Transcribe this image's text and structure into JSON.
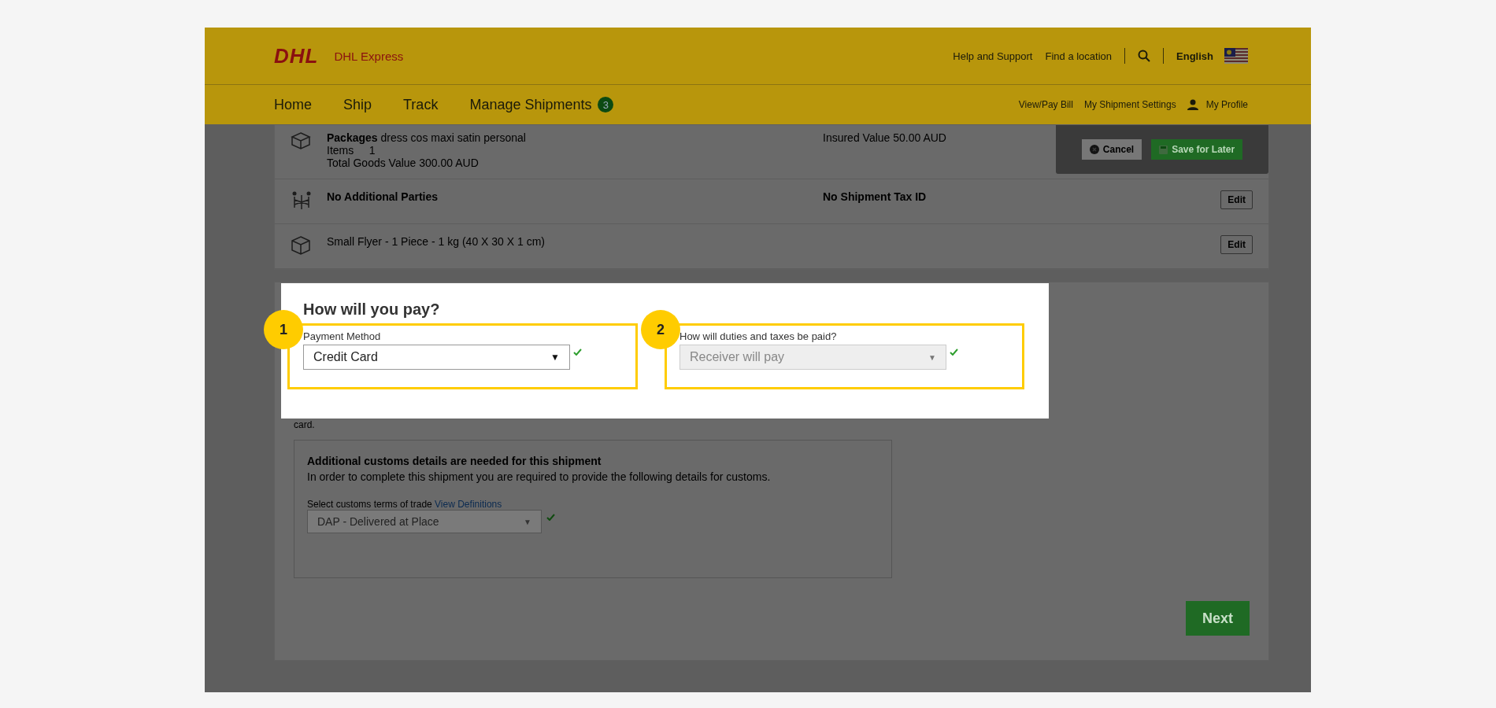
{
  "header": {
    "logo_mark": "DHL",
    "logo_name": "DHL Express",
    "links": [
      "Help and Support",
      "Find a location"
    ],
    "language": "English"
  },
  "nav": {
    "items": [
      {
        "label": "Home"
      },
      {
        "label": "Ship"
      },
      {
        "label": "Track"
      },
      {
        "label": "Manage Shipments",
        "badge": "3"
      }
    ],
    "right_links": [
      "View/Pay Bill",
      "My Shipment Settings"
    ],
    "profile": "My Profile"
  },
  "summary": {
    "rows": [
      {
        "kind": "packages",
        "lines": [
          "**Packages** dress cos maxi satin personal",
          "Items     1",
          "Total Goods Value 300.00 AUD"
        ],
        "right": "Insured Value 50.00 AUD"
      },
      {
        "kind": "parties",
        "lines": [
          "No Additional Parties"
        ],
        "right": "No Shipment Tax ID",
        "edit": "Edit"
      },
      {
        "kind": "box",
        "lines": [
          "Small Flyer - 1 Piece - 1 kg (40 X 30 X 1 cm)"
        ],
        "edit": "Edit"
      }
    ],
    "actions": {
      "cancel": "Cancel",
      "save": "Save for Later"
    }
  },
  "covered_text": "card.",
  "modal": {
    "title": "How will you pay?",
    "fields": [
      {
        "marker": "1",
        "label": "Payment Method",
        "value": "Credit Card",
        "caret": "▼",
        "disabled": false,
        "valid": true
      },
      {
        "marker": "2",
        "label": "How will duties and taxes be paid?",
        "value": "Receiver will pay",
        "caret": "▼",
        "disabled": true,
        "valid": true
      }
    ]
  },
  "customs": {
    "title": "Additional customs details are needed for this shipment",
    "text": "In order to complete this shipment you are required to provide the following details for customs.",
    "label": "Select customs terms of trade",
    "link": "View Definitions",
    "value": "DAP - Delivered at Place",
    "caret": "▼",
    "disabled": true,
    "valid": true
  },
  "next": "Next"
}
